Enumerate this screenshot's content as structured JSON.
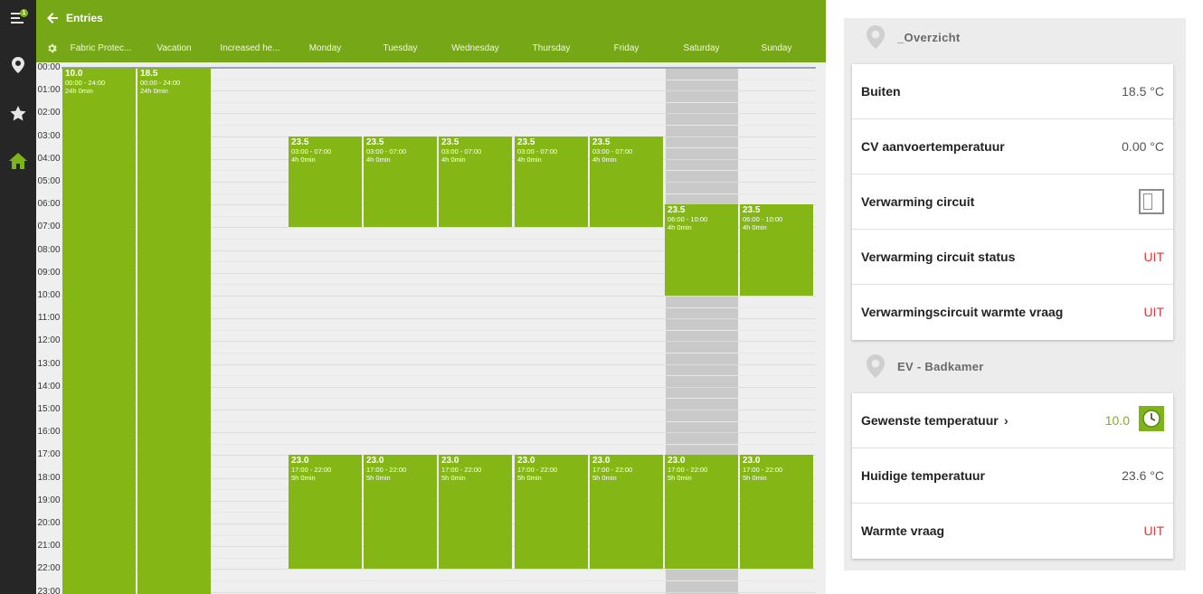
{
  "nav": {
    "badge_count": "1",
    "items": [
      {
        "icon": "menu-icon"
      },
      {
        "icon": "location-pin-icon"
      },
      {
        "icon": "star-icon"
      },
      {
        "icon": "home-icon"
      }
    ],
    "accent": "#7fb31a"
  },
  "calendar": {
    "title": "Entries",
    "header_color": "#76a716",
    "event_color": "#84b716",
    "columns": [
      "Fabric Protec...",
      "Vacation",
      "Increased he...",
      "Monday",
      "Tuesday",
      "Wednesday",
      "Thursday",
      "Friday",
      "Saturday",
      "Sunday"
    ],
    "hours": [
      "00:00",
      "01:00",
      "02:00",
      "03:00",
      "04:00",
      "05:00",
      "06:00",
      "07:00",
      "08:00",
      "09:00",
      "10:00",
      "11:00",
      "12:00",
      "13:00",
      "14:00",
      "15:00",
      "16:00",
      "17:00",
      "18:00",
      "19:00",
      "20:00",
      "21:00",
      "22:00",
      "23:00"
    ],
    "events": [
      {
        "col": 0,
        "start": 0,
        "end": 24,
        "temp": "10.0",
        "range": "00:00 - 24:00",
        "duration": "24h 0min"
      },
      {
        "col": 1,
        "start": 0,
        "end": 24,
        "temp": "18.5",
        "range": "00:00 - 24:00",
        "duration": "24h 0min"
      },
      {
        "col": 3,
        "start": 3,
        "end": 7,
        "temp": "23.5",
        "range": "03:00 - 07:00",
        "duration": "4h 0min"
      },
      {
        "col": 4,
        "start": 3,
        "end": 7,
        "temp": "23.5",
        "range": "03:00 - 07:00",
        "duration": "4h 0min"
      },
      {
        "col": 5,
        "start": 3,
        "end": 7,
        "temp": "23.5",
        "range": "03:00 - 07:00",
        "duration": "4h 0min"
      },
      {
        "col": 6,
        "start": 3,
        "end": 7,
        "temp": "23.5",
        "range": "03:00 - 07:00",
        "duration": "4h 0min"
      },
      {
        "col": 7,
        "start": 3,
        "end": 7,
        "temp": "23.5",
        "range": "03:00 - 07:00",
        "duration": "4h 0min"
      },
      {
        "col": 8,
        "start": 6,
        "end": 10,
        "temp": "23.5",
        "range": "06:00 - 10:00",
        "duration": "4h 0min"
      },
      {
        "col": 9,
        "start": 6,
        "end": 10,
        "temp": "23.5",
        "range": "06:00 - 10:00",
        "duration": "4h 0min"
      },
      {
        "col": 3,
        "start": 17,
        "end": 22,
        "temp": "23.0",
        "range": "17:00 - 22:00",
        "duration": "5h 0min"
      },
      {
        "col": 4,
        "start": 17,
        "end": 22,
        "temp": "23.0",
        "range": "17:00 - 22:00",
        "duration": "5h 0min"
      },
      {
        "col": 5,
        "start": 17,
        "end": 22,
        "temp": "23.0",
        "range": "17:00 - 22:00",
        "duration": "5h 0min"
      },
      {
        "col": 6,
        "start": 17,
        "end": 22,
        "temp": "23.0",
        "range": "17:00 - 22:00",
        "duration": "5h 0min"
      },
      {
        "col": 7,
        "start": 17,
        "end": 22,
        "temp": "23.0",
        "range": "17:00 - 22:00",
        "duration": "5h 0min"
      },
      {
        "col": 8,
        "start": 17,
        "end": 22,
        "temp": "23.0",
        "range": "17:00 - 22:00",
        "duration": "5h 0min"
      },
      {
        "col": 9,
        "start": 17,
        "end": 22,
        "temp": "23.0",
        "range": "17:00 - 22:00",
        "duration": "5h 0min"
      }
    ]
  },
  "overview": {
    "title": "_Overzicht",
    "rows": {
      "buiten": {
        "label": "Buiten",
        "value": "18.5 °C"
      },
      "cv": {
        "label": "CV aanvoertemperatuur",
        "value": "0.00 °C"
      },
      "circuit": {
        "label": "Verwarming circuit",
        "state": "off"
      },
      "circuit_status": {
        "label": "Verwarming circuit status",
        "value": "UIT"
      },
      "warmte_vraag": {
        "label": "Verwarmingscircuit warmte vraag",
        "value": "UIT"
      }
    }
  },
  "badkamer": {
    "title": "EV - Badkamer",
    "rows": {
      "gewenste": {
        "label": "Gewenste temperatuur",
        "value": "10.0"
      },
      "huidige": {
        "label": "Huidige temperatuur",
        "value": "23.6 °C"
      },
      "warmte": {
        "label": "Warmte vraag",
        "value": "UIT"
      }
    }
  }
}
